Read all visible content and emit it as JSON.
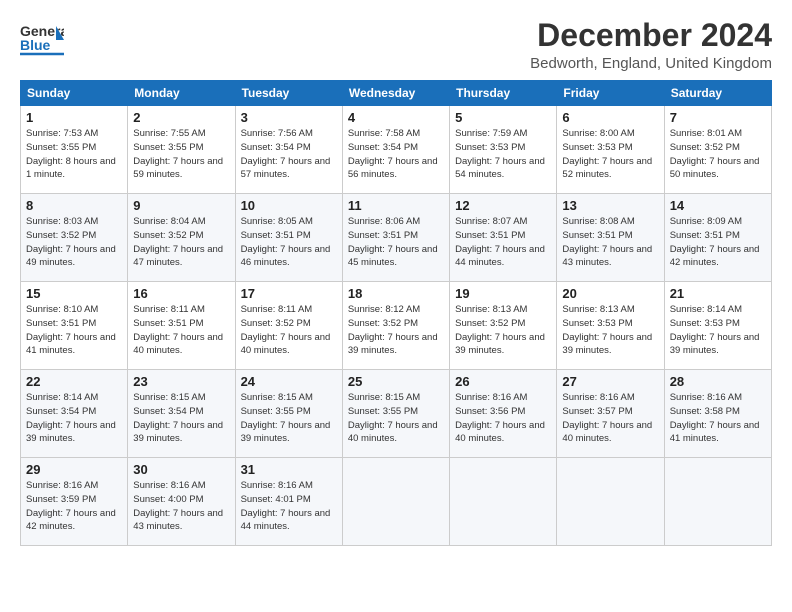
{
  "header": {
    "logo_general": "General",
    "logo_blue": "Blue",
    "main_title": "December 2024",
    "subtitle": "Bedworth, England, United Kingdom"
  },
  "calendar": {
    "days_of_week": [
      "Sunday",
      "Monday",
      "Tuesday",
      "Wednesday",
      "Thursday",
      "Friday",
      "Saturday"
    ],
    "weeks": [
      [
        {
          "day": "1",
          "sunrise": "Sunrise: 7:53 AM",
          "sunset": "Sunset: 3:55 PM",
          "daylight": "Daylight: 8 hours and 1 minute."
        },
        {
          "day": "2",
          "sunrise": "Sunrise: 7:55 AM",
          "sunset": "Sunset: 3:55 PM",
          "daylight": "Daylight: 7 hours and 59 minutes."
        },
        {
          "day": "3",
          "sunrise": "Sunrise: 7:56 AM",
          "sunset": "Sunset: 3:54 PM",
          "daylight": "Daylight: 7 hours and 57 minutes."
        },
        {
          "day": "4",
          "sunrise": "Sunrise: 7:58 AM",
          "sunset": "Sunset: 3:54 PM",
          "daylight": "Daylight: 7 hours and 56 minutes."
        },
        {
          "day": "5",
          "sunrise": "Sunrise: 7:59 AM",
          "sunset": "Sunset: 3:53 PM",
          "daylight": "Daylight: 7 hours and 54 minutes."
        },
        {
          "day": "6",
          "sunrise": "Sunrise: 8:00 AM",
          "sunset": "Sunset: 3:53 PM",
          "daylight": "Daylight: 7 hours and 52 minutes."
        },
        {
          "day": "7",
          "sunrise": "Sunrise: 8:01 AM",
          "sunset": "Sunset: 3:52 PM",
          "daylight": "Daylight: 7 hours and 50 minutes."
        }
      ],
      [
        {
          "day": "8",
          "sunrise": "Sunrise: 8:03 AM",
          "sunset": "Sunset: 3:52 PM",
          "daylight": "Daylight: 7 hours and 49 minutes."
        },
        {
          "day": "9",
          "sunrise": "Sunrise: 8:04 AM",
          "sunset": "Sunset: 3:52 PM",
          "daylight": "Daylight: 7 hours and 47 minutes."
        },
        {
          "day": "10",
          "sunrise": "Sunrise: 8:05 AM",
          "sunset": "Sunset: 3:51 PM",
          "daylight": "Daylight: 7 hours and 46 minutes."
        },
        {
          "day": "11",
          "sunrise": "Sunrise: 8:06 AM",
          "sunset": "Sunset: 3:51 PM",
          "daylight": "Daylight: 7 hours and 45 minutes."
        },
        {
          "day": "12",
          "sunrise": "Sunrise: 8:07 AM",
          "sunset": "Sunset: 3:51 PM",
          "daylight": "Daylight: 7 hours and 44 minutes."
        },
        {
          "day": "13",
          "sunrise": "Sunrise: 8:08 AM",
          "sunset": "Sunset: 3:51 PM",
          "daylight": "Daylight: 7 hours and 43 minutes."
        },
        {
          "day": "14",
          "sunrise": "Sunrise: 8:09 AM",
          "sunset": "Sunset: 3:51 PM",
          "daylight": "Daylight: 7 hours and 42 minutes."
        }
      ],
      [
        {
          "day": "15",
          "sunrise": "Sunrise: 8:10 AM",
          "sunset": "Sunset: 3:51 PM",
          "daylight": "Daylight: 7 hours and 41 minutes."
        },
        {
          "day": "16",
          "sunrise": "Sunrise: 8:11 AM",
          "sunset": "Sunset: 3:51 PM",
          "daylight": "Daylight: 7 hours and 40 minutes."
        },
        {
          "day": "17",
          "sunrise": "Sunrise: 8:11 AM",
          "sunset": "Sunset: 3:52 PM",
          "daylight": "Daylight: 7 hours and 40 minutes."
        },
        {
          "day": "18",
          "sunrise": "Sunrise: 8:12 AM",
          "sunset": "Sunset: 3:52 PM",
          "daylight": "Daylight: 7 hours and 39 minutes."
        },
        {
          "day": "19",
          "sunrise": "Sunrise: 8:13 AM",
          "sunset": "Sunset: 3:52 PM",
          "daylight": "Daylight: 7 hours and 39 minutes."
        },
        {
          "day": "20",
          "sunrise": "Sunrise: 8:13 AM",
          "sunset": "Sunset: 3:53 PM",
          "daylight": "Daylight: 7 hours and 39 minutes."
        },
        {
          "day": "21",
          "sunrise": "Sunrise: 8:14 AM",
          "sunset": "Sunset: 3:53 PM",
          "daylight": "Daylight: 7 hours and 39 minutes."
        }
      ],
      [
        {
          "day": "22",
          "sunrise": "Sunrise: 8:14 AM",
          "sunset": "Sunset: 3:54 PM",
          "daylight": "Daylight: 7 hours and 39 minutes."
        },
        {
          "day": "23",
          "sunrise": "Sunrise: 8:15 AM",
          "sunset": "Sunset: 3:54 PM",
          "daylight": "Daylight: 7 hours and 39 minutes."
        },
        {
          "day": "24",
          "sunrise": "Sunrise: 8:15 AM",
          "sunset": "Sunset: 3:55 PM",
          "daylight": "Daylight: 7 hours and 39 minutes."
        },
        {
          "day": "25",
          "sunrise": "Sunrise: 8:15 AM",
          "sunset": "Sunset: 3:55 PM",
          "daylight": "Daylight: 7 hours and 40 minutes."
        },
        {
          "day": "26",
          "sunrise": "Sunrise: 8:16 AM",
          "sunset": "Sunset: 3:56 PM",
          "daylight": "Daylight: 7 hours and 40 minutes."
        },
        {
          "day": "27",
          "sunrise": "Sunrise: 8:16 AM",
          "sunset": "Sunset: 3:57 PM",
          "daylight": "Daylight: 7 hours and 40 minutes."
        },
        {
          "day": "28",
          "sunrise": "Sunrise: 8:16 AM",
          "sunset": "Sunset: 3:58 PM",
          "daylight": "Daylight: 7 hours and 41 minutes."
        }
      ],
      [
        {
          "day": "29",
          "sunrise": "Sunrise: 8:16 AM",
          "sunset": "Sunset: 3:59 PM",
          "daylight": "Daylight: 7 hours and 42 minutes."
        },
        {
          "day": "30",
          "sunrise": "Sunrise: 8:16 AM",
          "sunset": "Sunset: 4:00 PM",
          "daylight": "Daylight: 7 hours and 43 minutes."
        },
        {
          "day": "31",
          "sunrise": "Sunrise: 8:16 AM",
          "sunset": "Sunset: 4:01 PM",
          "daylight": "Daylight: 7 hours and 44 minutes."
        },
        null,
        null,
        null,
        null
      ]
    ]
  }
}
